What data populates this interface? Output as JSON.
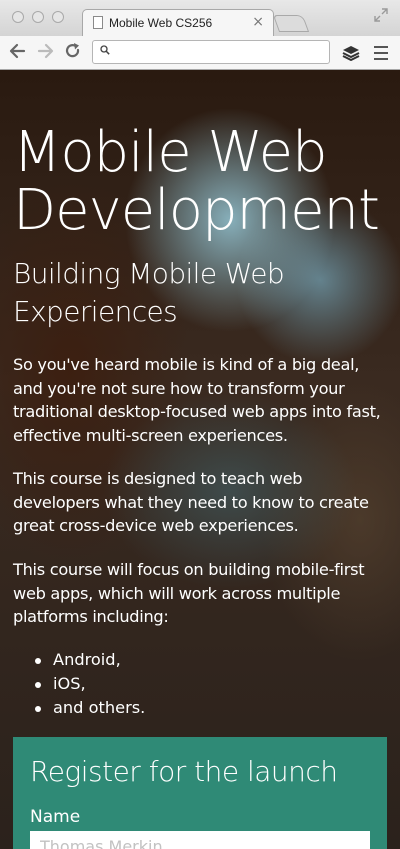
{
  "browser": {
    "tab_title": "Mobile Web CS256",
    "tab_close": "×",
    "address": ""
  },
  "page": {
    "title": "Mobile Web Development",
    "subtitle": "Building Mobile Web Experiences",
    "paragraphs": [
      "So you've heard mobile is kind of a big deal, and you're not sure how to transform your traditional desktop-focused web apps into fast, effective multi-screen experiences.",
      "This course is designed to teach web developers what they need to know to create great cross-device web experiences.",
      "This course will focus on building mobile-first web apps, which will work across multiple platforms including:"
    ],
    "platforms": [
      "Android,",
      "iOS,",
      "and others."
    ]
  },
  "register": {
    "heading": "Register for the launch",
    "name_label": "Name",
    "name_placeholder": "Thomas Merkin"
  },
  "colors": {
    "register_bg": "#2f8a76"
  }
}
